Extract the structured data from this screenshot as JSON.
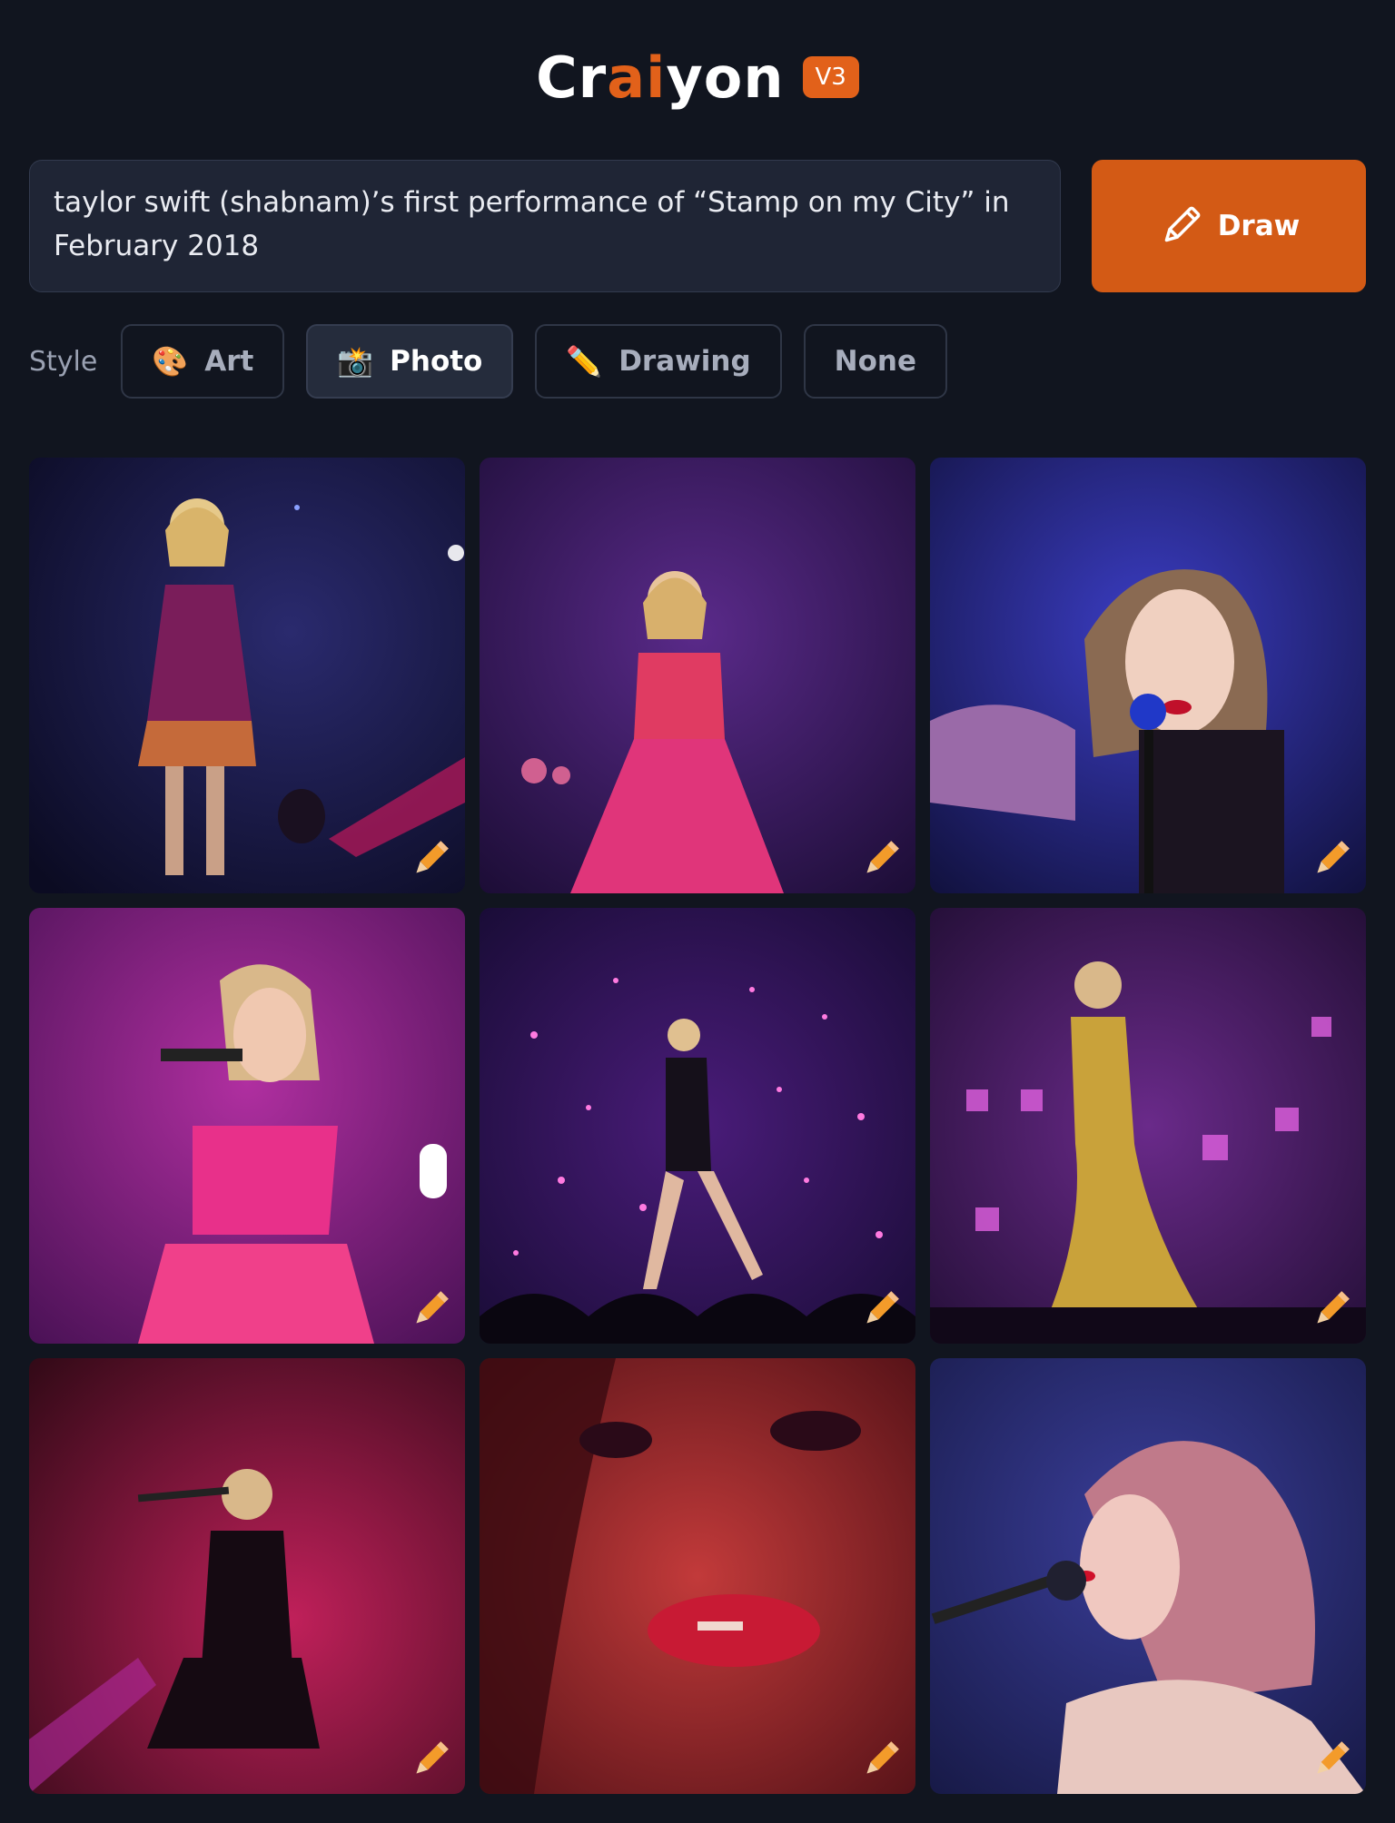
{
  "header": {
    "logo_part1": "Cr",
    "logo_part2": "ai",
    "logo_part3": "yon",
    "version": "V3"
  },
  "prompt": {
    "value": "taylor swift (shabnam)’s first performance of “Stamp on my City” in February 2018"
  },
  "draw_button": {
    "label": "Draw",
    "icon": "pencil-icon"
  },
  "style": {
    "label": "Style",
    "options": [
      {
        "label": "Art",
        "icon": "🎨",
        "active": false
      },
      {
        "label": "Photo",
        "icon": "📸",
        "active": true
      },
      {
        "label": "Drawing",
        "icon": "✏️",
        "active": false
      },
      {
        "label": "None",
        "icon": "",
        "active": false
      }
    ]
  },
  "colors": {
    "background": "#11151f",
    "accent": "#e2611a",
    "panel": "#1f2535"
  },
  "results": [
    {
      "description_icon": "photo-thumbnail",
      "edit_icon": "pencil-icon"
    },
    {
      "description_icon": "photo-thumbnail",
      "edit_icon": "pencil-icon"
    },
    {
      "description_icon": "photo-thumbnail",
      "edit_icon": "pencil-icon"
    },
    {
      "description_icon": "photo-thumbnail",
      "edit_icon": "pencil-icon"
    },
    {
      "description_icon": "photo-thumbnail",
      "edit_icon": "pencil-icon"
    },
    {
      "description_icon": "photo-thumbnail",
      "edit_icon": "pencil-icon"
    },
    {
      "description_icon": "photo-thumbnail",
      "edit_icon": "pencil-icon"
    },
    {
      "description_icon": "photo-thumbnail",
      "edit_icon": "pencil-icon"
    },
    {
      "description_icon": "photo-thumbnail",
      "edit_icon": "pencil-icon"
    }
  ]
}
